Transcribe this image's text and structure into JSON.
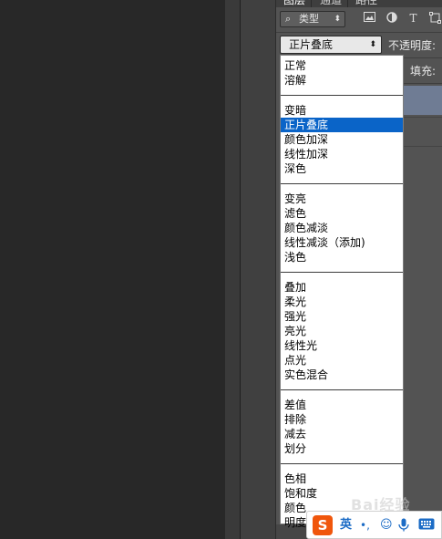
{
  "panel": {
    "tabs": [
      "图层",
      "通道",
      "路径"
    ]
  },
  "filter": {
    "search_glyph": "⌕",
    "label": "类型",
    "arrow": "⬍",
    "icons": [
      "image-filter-icon",
      "adjustment-filter-icon",
      "type-filter-icon",
      "shape-filter-icon"
    ],
    "type_glyph": "T"
  },
  "blend": {
    "current": "正片叠底",
    "arrow": "⬍"
  },
  "opacity_label": "不透明度:",
  "fill_label": "填充:",
  "blend_modes": {
    "groups": [
      [
        "正常",
        "溶解"
      ],
      [
        "变暗",
        "正片叠底",
        "颜色加深",
        "线性加深",
        "深色"
      ],
      [
        "变亮",
        "滤色",
        "颜色减淡",
        "线性减淡（添加)",
        "浅色"
      ],
      [
        "叠加",
        "柔光",
        "强光",
        "亮光",
        "线性光",
        "点光",
        "实色混合"
      ],
      [
        "差值",
        "排除",
        "减去",
        "划分"
      ],
      [
        "色相",
        "饱和度",
        "颜色",
        "明度"
      ]
    ],
    "selected": "正片叠底"
  },
  "ime": {
    "logo": "S",
    "lang": "英",
    "punct": "•,",
    "emoji": "☺",
    "mic": "🎙",
    "kbd": "⌨"
  },
  "watermark": "Bai经验",
  "colors": {
    "selected_item": "#0a64c8",
    "panel_bg": "#535353",
    "selected_layer": "#6f7c94",
    "ime_accent": "#1c6cc6"
  }
}
